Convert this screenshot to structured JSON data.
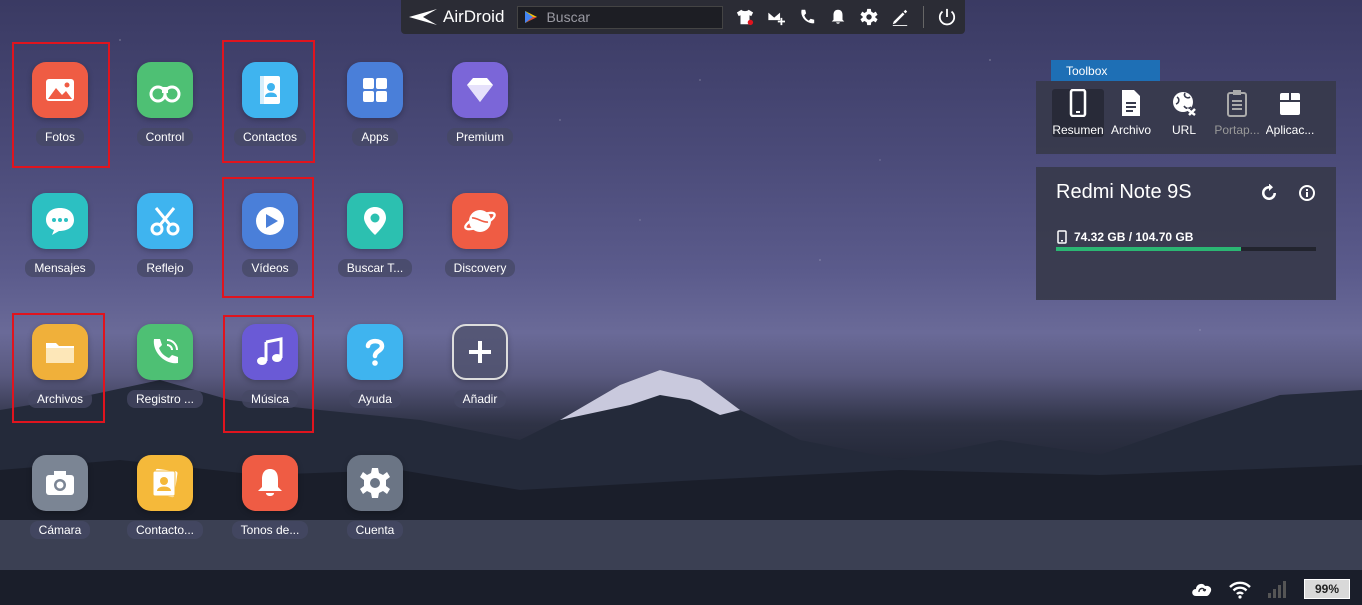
{
  "topbar": {
    "brand": "AirDroid",
    "search_placeholder": "Buscar"
  },
  "apps": [
    {
      "label": "Fotos",
      "icon": "photos-icon",
      "color": "#ef5c44"
    },
    {
      "label": "Control",
      "icon": "binoculars-icon",
      "color": "#4ec074"
    },
    {
      "label": "Contactos",
      "icon": "contacts-icon",
      "color": "#3fb4ef"
    },
    {
      "label": "Apps",
      "icon": "apps-grid-icon",
      "color": "#4a7fd9"
    },
    {
      "label": "Premium",
      "icon": "diamond-icon",
      "color": "#7b66d8"
    },
    {
      "label": "Mensajes",
      "icon": "message-icon",
      "color": "#2cc0c2"
    },
    {
      "label": "Reflejo",
      "icon": "scissors-icon",
      "color": "#3fb4ef"
    },
    {
      "label": "Vídeos",
      "icon": "play-icon",
      "color": "#4a7fd9"
    },
    {
      "label": "Buscar T...",
      "icon": "location-pin-icon",
      "color": "#2cc0b0"
    },
    {
      "label": "Discovery",
      "icon": "planet-icon",
      "color": "#ef5c44"
    },
    {
      "label": "Archivos",
      "icon": "folder-icon",
      "color": "#f0b03a"
    },
    {
      "label": "Registro ...",
      "icon": "phone-call-icon",
      "color": "#4ec074"
    },
    {
      "label": "Música",
      "icon": "music-note-icon",
      "color": "#6a5ad6"
    },
    {
      "label": "Ayuda",
      "icon": "question-icon",
      "color": "#3fb4ef"
    },
    {
      "label": "Añadir",
      "icon": "add-icon",
      "color": "#555770"
    },
    {
      "label": "Cámara",
      "icon": "camera-icon",
      "color": "#7b8594"
    },
    {
      "label": "Contacto...",
      "icon": "contact-card-icon",
      "color": "#f5b93a"
    },
    {
      "label": "Tonos de...",
      "icon": "bell-icon",
      "color": "#ef5c44"
    },
    {
      "label": "Cuenta",
      "icon": "gear-icon",
      "color": "#6b7585"
    }
  ],
  "toolbox": {
    "tab_label": "Toolbox",
    "tools": [
      {
        "label": "Resumen",
        "icon": "phone-icon"
      },
      {
        "label": "Archivo",
        "icon": "file-icon"
      },
      {
        "label": "URL",
        "icon": "globe-link-icon"
      },
      {
        "label": "Portap...",
        "icon": "clipboard-icon"
      },
      {
        "label": "Aplicac...",
        "icon": "app-box-icon"
      }
    ]
  },
  "device": {
    "name": "Redmi Note 9S",
    "storage_text": "74.32 GB / 104.70 GB",
    "storage_used_fraction": 0.7098
  },
  "status": {
    "battery": "99%"
  },
  "colors": {
    "highlight": "#e0141e",
    "storage_bar": "#2bb673",
    "toolbox_tab": "#1e6fb5"
  }
}
